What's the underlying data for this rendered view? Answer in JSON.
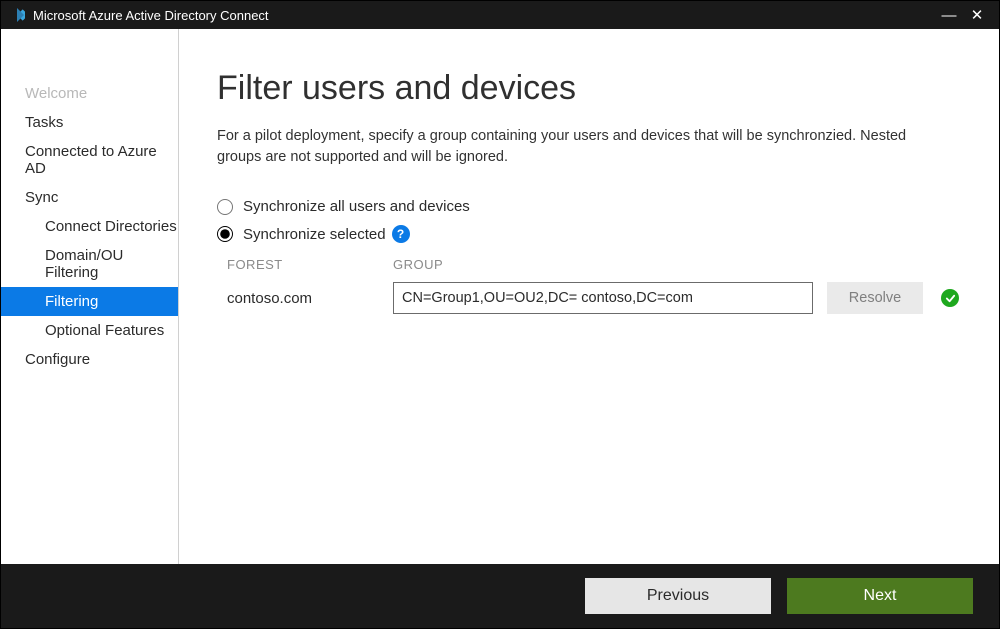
{
  "window": {
    "title": "Microsoft Azure Active Directory Connect"
  },
  "sidebar": {
    "items": [
      {
        "label": "Welcome"
      },
      {
        "label": "Tasks"
      },
      {
        "label": "Connected to Azure AD"
      },
      {
        "label": "Sync"
      },
      {
        "label": "Connect Directories"
      },
      {
        "label": "Domain/OU Filtering"
      },
      {
        "label": "Filtering"
      },
      {
        "label": "Optional Features"
      },
      {
        "label": "Configure"
      }
    ]
  },
  "main": {
    "heading": "Filter users and devices",
    "description": "For a pilot deployment, specify a group containing your users and devices that will be synchronzied. Nested groups are not supported and will be ignored.",
    "option_all": "Synchronize all users and devices",
    "option_selected": "Synchronize selected",
    "headers": {
      "forest": "FOREST",
      "group": "GROUP"
    },
    "row": {
      "forest": "contoso.com",
      "group_value": "CN=Group1,OU=OU2,DC= contoso,DC=com",
      "resolve": "Resolve"
    },
    "help_glyph": "?"
  },
  "footer": {
    "previous": "Previous",
    "next": "Next"
  },
  "colors": {
    "accent": "#0b7ae6",
    "next_button": "#4d7a1f",
    "success": "#1ea81e"
  }
}
